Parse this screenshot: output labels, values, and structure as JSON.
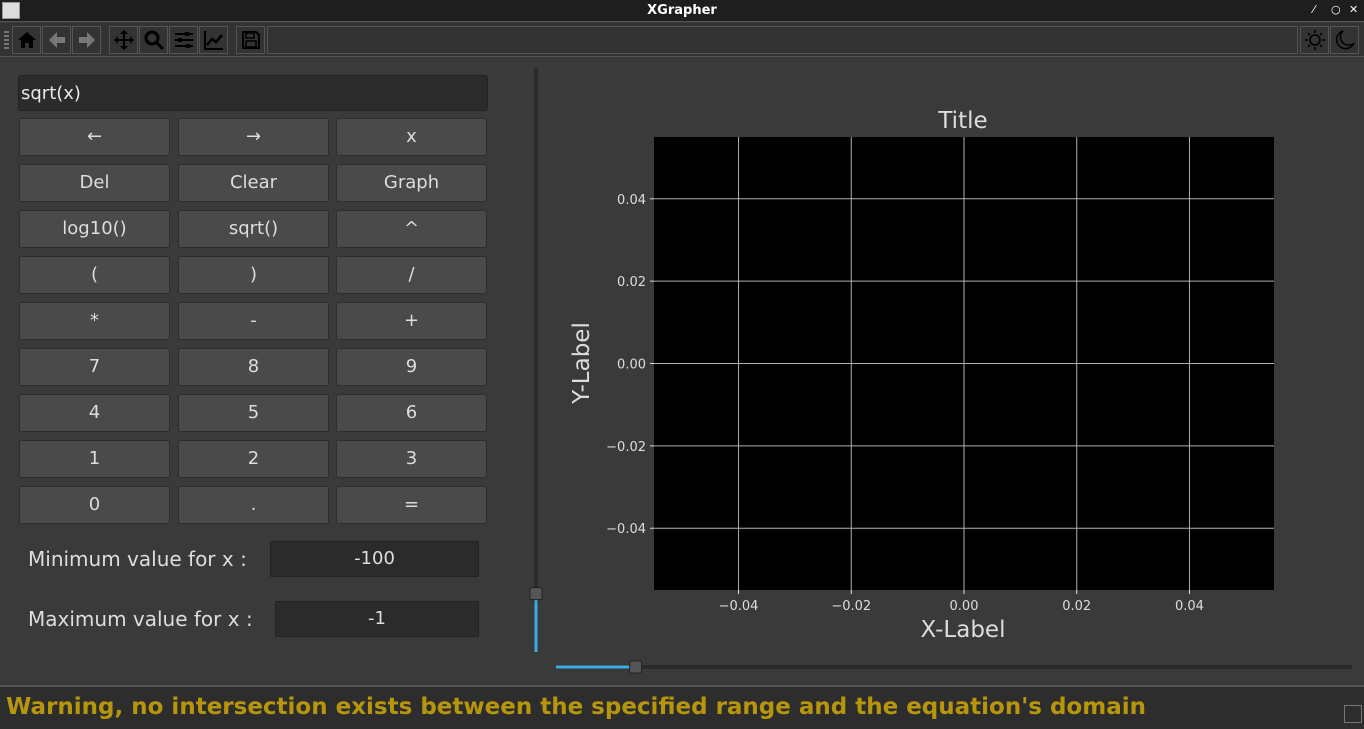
{
  "window": {
    "title": "XGrapher"
  },
  "toolbar": {
    "icons": [
      "home-icon",
      "back-arrow-icon",
      "forward-arrow-icon",
      "pan-icon",
      "zoom-icon",
      "configure-subplots-icon",
      "edit-axis-icon",
      "save-icon"
    ],
    "theme_icons": [
      "light-theme-icon",
      "dark-theme-icon"
    ]
  },
  "equation": {
    "value": "sqrt(x)"
  },
  "keypad": [
    [
      "←",
      "→",
      "x"
    ],
    [
      "Del",
      "Clear",
      "Graph"
    ],
    [
      "log10()",
      "sqrt()",
      "^"
    ],
    [
      "(",
      ")",
      "/"
    ],
    [
      "*",
      "-",
      "+"
    ],
    [
      "7",
      "8",
      "9"
    ],
    [
      "4",
      "5",
      "6"
    ],
    [
      "1",
      "2",
      "3"
    ],
    [
      "0",
      ".",
      "="
    ]
  ],
  "range": {
    "min_label": "Minimum value for x :",
    "min_value": "-100",
    "max_label": "Maximum value for x :",
    "max_value": "-1"
  },
  "sliders": {
    "vertical_value": 0.1,
    "horizontal_value": 0.1,
    "accent": "#3daee9"
  },
  "chart_data": {
    "type": "line",
    "title": "Title",
    "xlabel": "X-Label",
    "ylabel": "Y-Label",
    "xlim": [
      -0.055,
      0.055
    ],
    "ylim": [
      -0.055,
      0.055
    ],
    "xticks": [
      "−0.04",
      "−0.02",
      "0.00",
      "0.02",
      "0.04"
    ],
    "yticks": [
      "0.04",
      "0.02",
      "0.00",
      "−0.02",
      "−0.04"
    ],
    "xtick_values": [
      -0.04,
      -0.02,
      0,
      0.02,
      0.04
    ],
    "ytick_values": [
      0.04,
      0.02,
      0,
      -0.02,
      -0.04
    ],
    "grid": true,
    "background": "#000000",
    "series": []
  },
  "status": {
    "message": "Warning, no intersection exists between the specified range and the equation's domain",
    "color": "#b8960b"
  }
}
